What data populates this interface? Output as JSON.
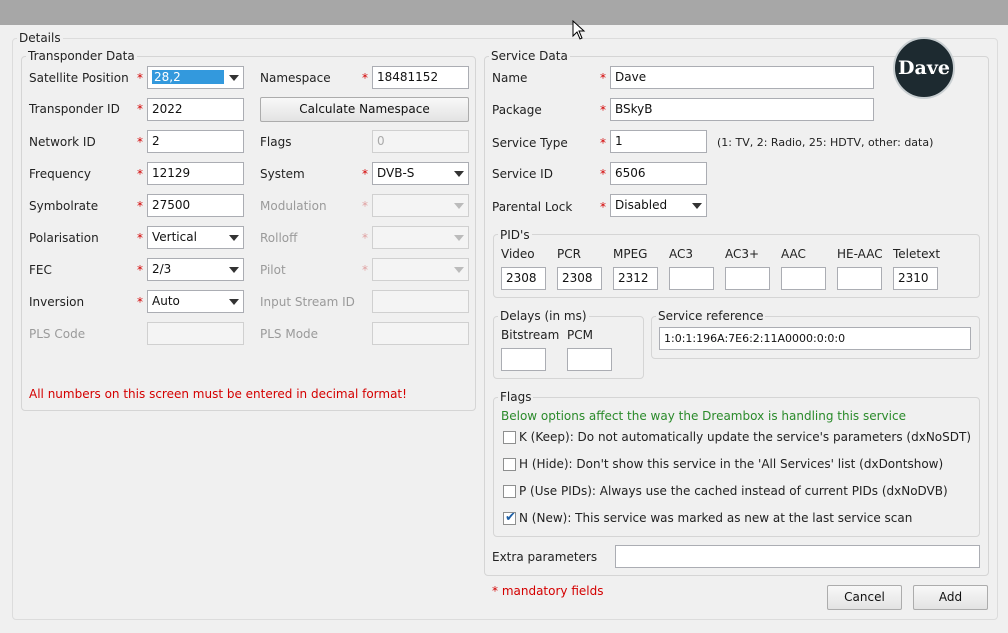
{
  "details_title": "Details",
  "transponder": {
    "title": "Transponder Data",
    "satellite_position": {
      "label": "Satellite Position",
      "value": "28,2"
    },
    "namespace": {
      "label": "Namespace",
      "value": "18481152"
    },
    "transponder_id": {
      "label": "Transponder ID",
      "value": "2022"
    },
    "calculate_namespace_label": "Calculate Namespace",
    "network_id": {
      "label": "Network ID",
      "value": "2"
    },
    "flags": {
      "label": "Flags",
      "value": "0"
    },
    "frequency": {
      "label": "Frequency",
      "value": "12129"
    },
    "system": {
      "label": "System",
      "value": "DVB-S"
    },
    "symbolrate": {
      "label": "Symbolrate",
      "value": "27500"
    },
    "modulation": {
      "label": "Modulation",
      "value": ""
    },
    "polarisation": {
      "label": "Polarisation",
      "value": "Vertical"
    },
    "rolloff": {
      "label": "Rolloff",
      "value": ""
    },
    "fec": {
      "label": "FEC",
      "value": "2/3"
    },
    "pilot": {
      "label": "Pilot",
      "value": ""
    },
    "inversion": {
      "label": "Inversion",
      "value": "Auto"
    },
    "input_stream_id": {
      "label": "Input Stream ID",
      "value": ""
    },
    "pls_code": {
      "label": "PLS Code",
      "value": ""
    },
    "pls_mode": {
      "label": "PLS Mode",
      "value": ""
    },
    "warning": "All numbers on this screen must be entered in decimal format!"
  },
  "service": {
    "title": "Service Data",
    "logo_text": "Dave",
    "name": {
      "label": "Name",
      "value": "Dave"
    },
    "package": {
      "label": "Package",
      "value": "BSkyB"
    },
    "service_type": {
      "label": "Service Type",
      "value": "1",
      "hint": "(1: TV, 2: Radio, 25: HDTV, other: data)"
    },
    "service_id": {
      "label": "Service ID",
      "value": "6506"
    },
    "parental_lock": {
      "label": "Parental Lock",
      "value": "Disabled"
    },
    "pids": {
      "title": "PID's",
      "video": {
        "label": "Video",
        "value": "2308"
      },
      "pcr": {
        "label": "PCR",
        "value": "2308"
      },
      "mpeg": {
        "label": "MPEG",
        "value": "2312"
      },
      "ac3": {
        "label": "AC3",
        "value": ""
      },
      "ac3plus": {
        "label": "AC3+",
        "value": ""
      },
      "aac": {
        "label": "AAC",
        "value": ""
      },
      "heaac": {
        "label": "HE-AAC",
        "value": ""
      },
      "teletext": {
        "label": "Teletext",
        "value": "2310"
      }
    },
    "delays": {
      "title": "Delays (in ms)",
      "bitstream": {
        "label": "Bitstream",
        "value": ""
      },
      "pcm": {
        "label": "PCM",
        "value": ""
      }
    },
    "service_reference": {
      "title": "Service reference",
      "value": "1:0:1:196A:7E6:2:11A0000:0:0:0"
    },
    "flags": {
      "title": "Flags",
      "note": "Below options affect the way the Dreambox is handling this service",
      "keep": {
        "label": "K (Keep): Do not automatically update the service's parameters (dxNoSDT)",
        "checked": false
      },
      "hide": {
        "label": "H (Hide): Don't show this service in the 'All Services' list (dxDontshow)",
        "checked": false
      },
      "use_pids": {
        "label": "P (Use PIDs): Always use the cached instead of current PIDs (dxNoDVB)",
        "checked": false
      },
      "new": {
        "label": "N (New): This service was marked as new at the last service scan",
        "checked": true
      }
    },
    "extra_parameters": {
      "label": "Extra parameters",
      "value": ""
    }
  },
  "mandatory_note": "* mandatory fields",
  "required_mark": "*",
  "buttons": {
    "cancel": "Cancel",
    "add": "Add"
  },
  "colors": {
    "required": "#d40000",
    "note": "#2a8a2a",
    "selection": "#3399dd"
  }
}
